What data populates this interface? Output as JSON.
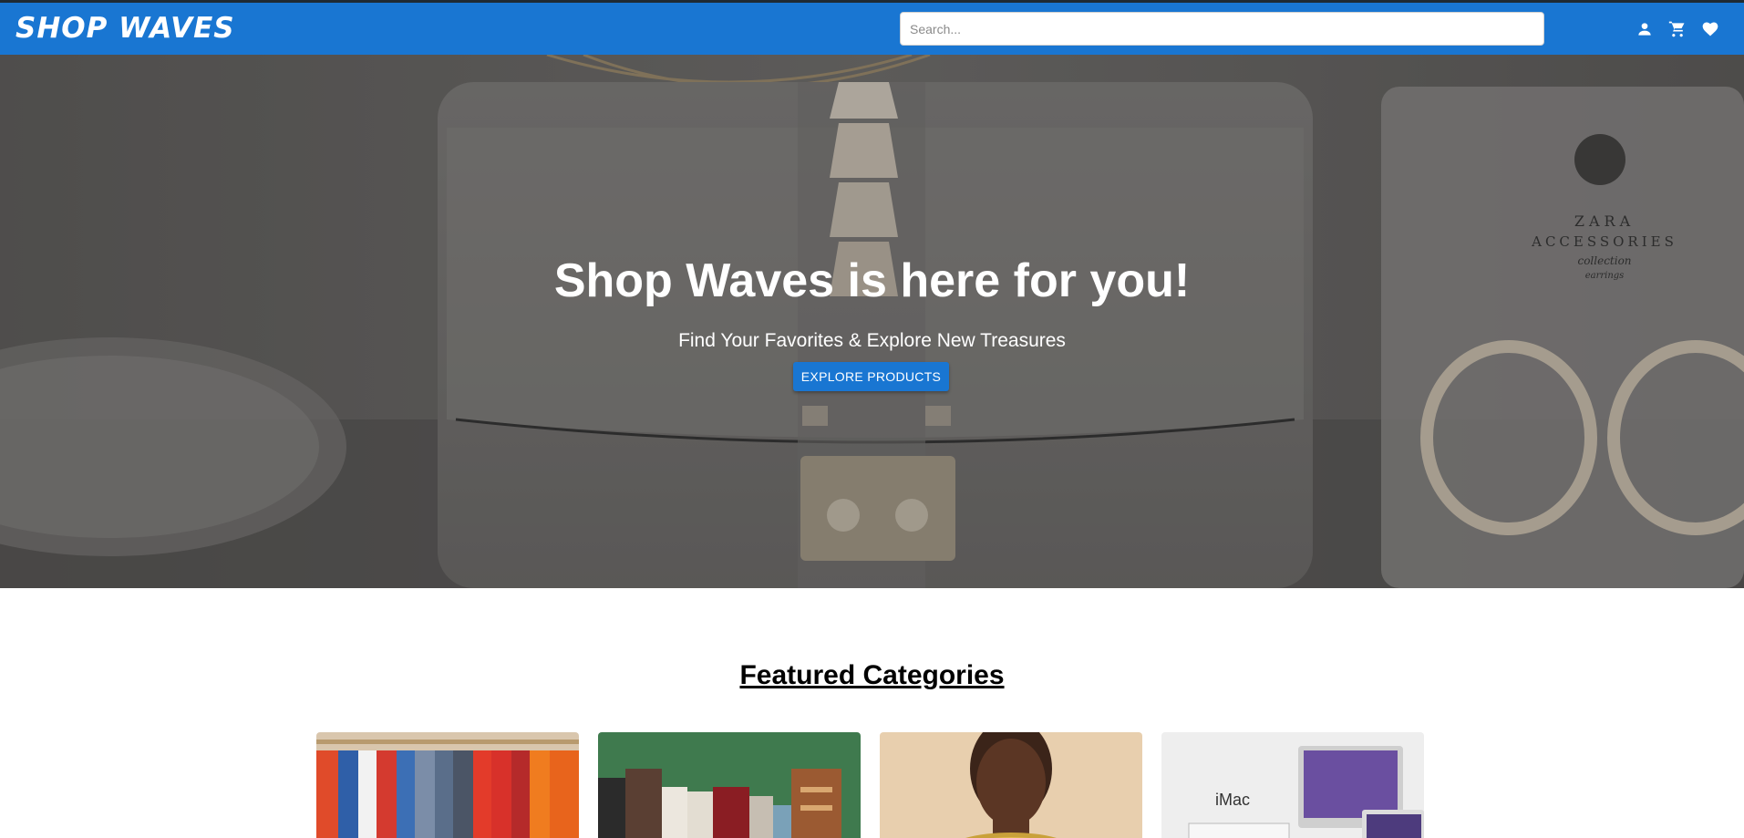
{
  "header": {
    "logo": "SHOP WAVES",
    "search_placeholder": "Search...",
    "icons": [
      "account-icon",
      "cart-icon",
      "heart-icon"
    ]
  },
  "hero": {
    "title": "Shop Waves is here for you!",
    "subtitle": "Find Your Favorites & Explore New Treasures",
    "cta_label": "EXPLORE PRODUCTS",
    "image_text_line1": "ZARA",
    "image_text_line2": "ACCESSORIES",
    "image_text_line3": "collection",
    "image_text_line4": "earrings"
  },
  "featured": {
    "title": "Featured Categories",
    "cards": [
      {
        "image": "clothing-rack"
      },
      {
        "image": "books"
      },
      {
        "image": "jewelry-model"
      },
      {
        "image": "electronics",
        "image_text": "iMac"
      }
    ]
  },
  "colors": {
    "primary": "#1976d2",
    "white": "#ffffff"
  }
}
